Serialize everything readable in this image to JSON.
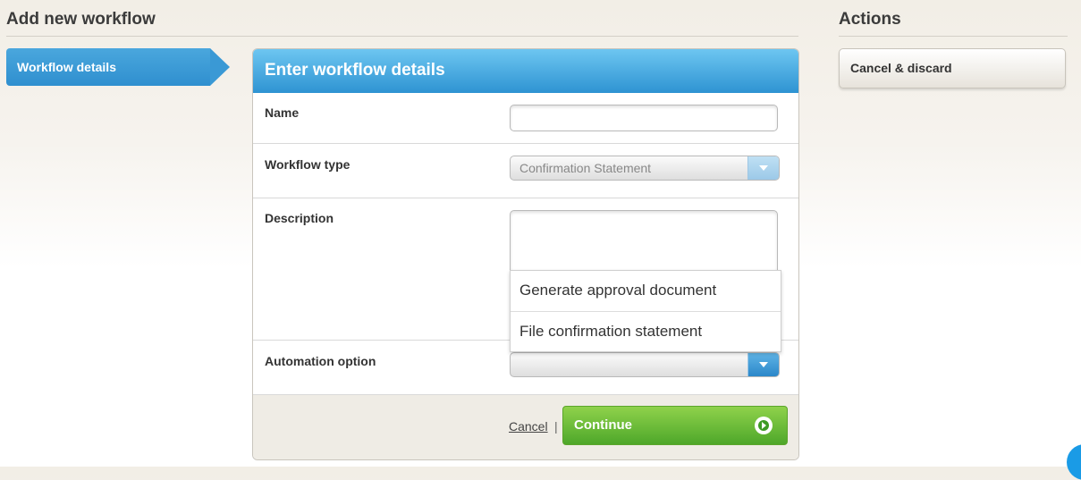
{
  "page_title": "Add new workflow",
  "steps": [
    {
      "label": "Workflow details"
    }
  ],
  "form": {
    "header": "Enter workflow details",
    "name_label": "Name",
    "name_value": "",
    "workflow_type_label": "Workflow type",
    "workflow_type_value": "Confirmation Statement",
    "description_label": "Description",
    "description_value": "",
    "automation_label": "Automation option",
    "automation_value": "",
    "automation_options": [
      "Generate approval document",
      "File confirmation statement"
    ],
    "cancel_label": "Cancel",
    "separator": "|",
    "continue_label": "Continue"
  },
  "actions": {
    "title": "Actions",
    "cancel_discard_label": "Cancel & discard"
  },
  "colors": {
    "accent_blue": "#2e93d2",
    "continue_green": "#4ea72a"
  }
}
